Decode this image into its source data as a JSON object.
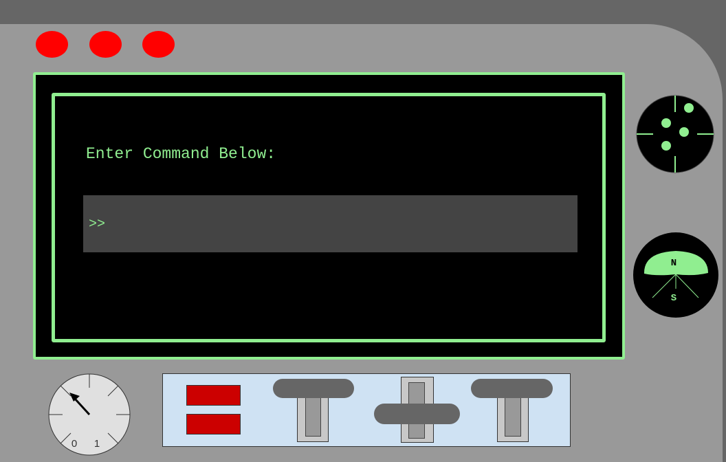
{
  "colors": {
    "frame": "#666666",
    "panel": "#999999",
    "accent": "#90ee90",
    "indicator": "#ff0000",
    "field": "#444444",
    "control_panel": "#cfe2f3",
    "switch": "#cc0000",
    "handle": "#666666"
  },
  "terminal": {
    "prompt_label": "Enter Command Below:",
    "prompt_chevrons": ">>",
    "input_value": "",
    "input_placeholder": ""
  },
  "compass": {
    "north_label": "N",
    "south_label": "S"
  },
  "dial": {
    "label_0": "0",
    "label_1": "1"
  },
  "radar": {
    "icon": "radar-icon"
  },
  "indicator_lights": [
    "red",
    "red",
    "red"
  ]
}
